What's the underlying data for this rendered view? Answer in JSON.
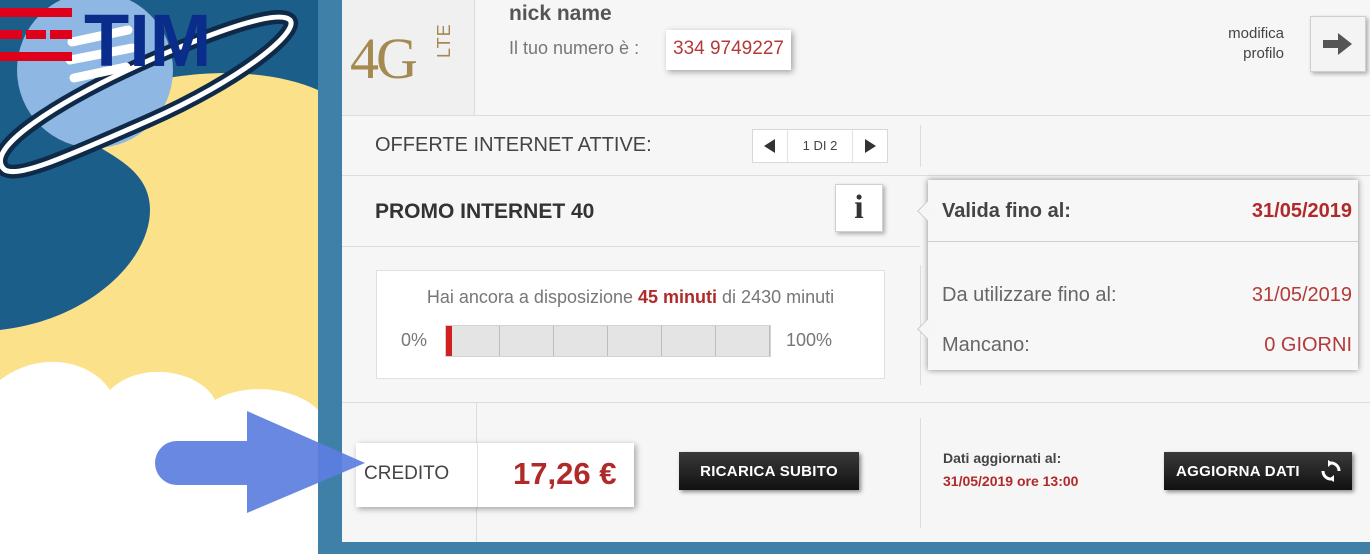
{
  "header": {
    "logo_main": "4G",
    "logo_sub": "LTE",
    "nickname": "nick name",
    "number_label": "Il tuo numero è :",
    "number_value": "334 9749227",
    "edit_profile_label_1": "modifica",
    "edit_profile_label_2": "profilo"
  },
  "offers": {
    "label": "OFFERTE INTERNET ATTIVE:",
    "pager_text": "1 DI 2"
  },
  "promo": {
    "title": "PROMO INTERNET 40",
    "info_glyph": "i",
    "usage_prefix": "Hai ancora a disposizione",
    "usage_highlight": "45 minuti",
    "usage_suffix": "di 2430 minuti",
    "bar_min_label": "0%",
    "bar_max_label": "100%",
    "used_fraction": 0.02
  },
  "validity": {
    "valid_until_label": "Valida fino al:",
    "valid_until_value": "31/05/2019",
    "use_until_label": "Da utilizzare fino al:",
    "use_until_value": "31/05/2019",
    "remaining_label": "Mancano:",
    "remaining_value": "0 GIORNI"
  },
  "credit": {
    "label": "CREDITO",
    "value": "17,26 €",
    "recharge_button": "RICARICA SUBITO"
  },
  "update": {
    "label": "Dati aggiornati al:",
    "value": "31/05/2019 ore 13:00",
    "refresh_button": "AGGIORNA DATI"
  },
  "brand": {
    "name": "TIM",
    "color_red": "#e1001a",
    "color_blue": "#0a2d8c",
    "accent_red": "#b02a2a",
    "arrow_color": "#5b7ee0"
  },
  "icons": {
    "arrow_right": "arrow-right-icon",
    "refresh": "refresh-icon",
    "prev": "caret-left-icon",
    "next": "caret-right-icon"
  }
}
